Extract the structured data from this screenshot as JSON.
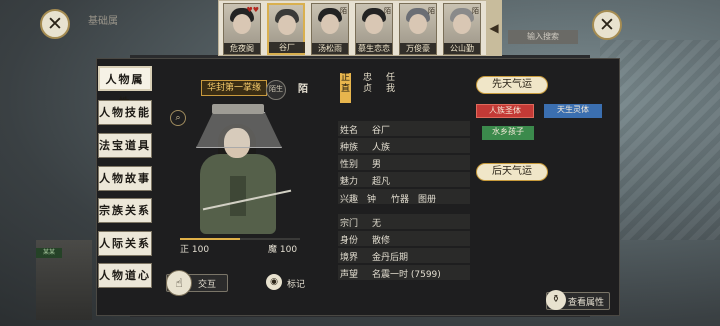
{
  "top_roster": [
    {
      "name": "危夜阁",
      "tag": "♥♥",
      "selected": false
    },
    {
      "name": "谷厂",
      "tag": "",
      "selected": true
    },
    {
      "name": "汤松雨",
      "tag": "陌",
      "selected": false
    },
    {
      "name": "慕生恋恋",
      "tag": "陌",
      "selected": false
    },
    {
      "name": "万俊豪",
      "tag": "陌",
      "selected": false
    },
    {
      "name": "公山勤",
      "tag": "陌",
      "selected": false
    }
  ],
  "faded": {
    "title": "基础属",
    "right": "输入搜索",
    "left_name": "某某"
  },
  "tabs": [
    "人物属性",
    "人物技能",
    "法宝道具",
    "人物故事",
    "宗族关系",
    "人际关系",
    "人物道心"
  ],
  "character": {
    "title": "华封第一掌缘",
    "title_seal": "陌生",
    "surname_tag": "陌",
    "righteous": "正 100",
    "demonic": "魔 100",
    "righteous_fraction": 0.5
  },
  "trait_tabs": [
    "正直",
    "忠贞",
    "任我"
  ],
  "info": [
    {
      "key": "姓名",
      "value": "谷厂"
    },
    {
      "key": "种族",
      "value": "人族"
    },
    {
      "key": "性别",
      "value": "男"
    },
    {
      "key": "魅力",
      "value": "超凡"
    }
  ],
  "hobby": {
    "key": "兴趣",
    "values": [
      "钟",
      "竹器",
      "图册"
    ]
  },
  "info2": [
    {
      "key": "宗门",
      "value": "无"
    },
    {
      "key": "身份",
      "value": "散修"
    },
    {
      "key": "境界",
      "value": "金丹后期"
    },
    {
      "key": "声望",
      "value": "名震一时 (7599)"
    }
  ],
  "luck": {
    "innate_header": "先天气运",
    "innate": [
      {
        "label": "人族圣体",
        "color": "#c43a36"
      },
      {
        "label": "天生灵体",
        "color": "#3b6fb0"
      },
      {
        "label": "水乡孩子",
        "color": "#3b8a4c"
      }
    ],
    "acquired_header": "后天气运"
  },
  "buttons": {
    "interact": "交互",
    "mark": "标记",
    "view_attributes": "查看属性"
  },
  "icons": {
    "close": "close-icon",
    "search": "search-icon",
    "interact": "hand-icon",
    "mark": "eye-icon",
    "view": "gourd-icon"
  }
}
